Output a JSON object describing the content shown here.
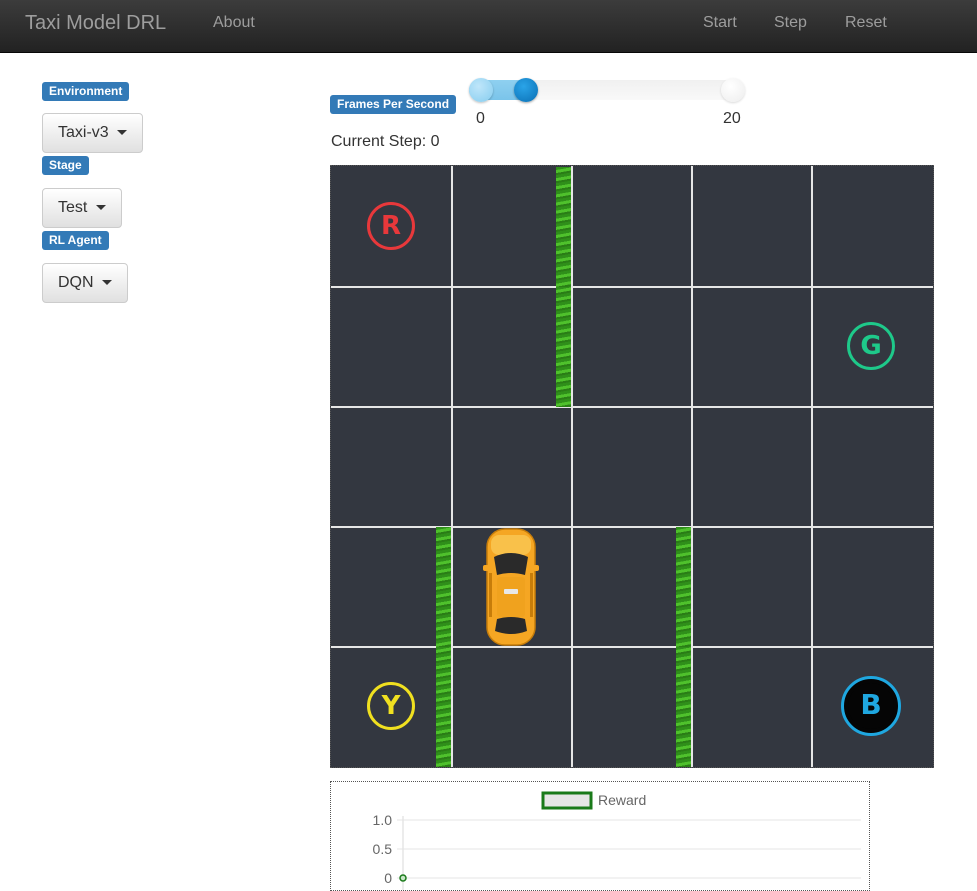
{
  "nav": {
    "brand": "Taxi Model DRL",
    "about": "About",
    "start": "Start",
    "step": "Step",
    "reset": "Reset"
  },
  "sidebar": {
    "environment_label": "Environment",
    "environment_value": "Taxi-v3",
    "stage_label": "Stage",
    "stage_value": "Test",
    "agent_label": "RL Agent",
    "agent_value": "DQN"
  },
  "controls": {
    "fps_label": "Frames Per Second",
    "slider_min": "0",
    "slider_max": "20",
    "slider_value_fraction": 0.15,
    "current_step_text": "Current Step: 0"
  },
  "grid": {
    "rows": 5,
    "cols": 5,
    "locations": [
      {
        "letter": "R",
        "row": 0,
        "col": 0,
        "color": "#e8383b",
        "style": "outline"
      },
      {
        "letter": "G",
        "row": 1,
        "col": 4,
        "color": "#1ec98a",
        "style": "outline"
      },
      {
        "letter": "Y",
        "row": 4,
        "col": 0,
        "color": "#f0e020",
        "style": "outline"
      },
      {
        "letter": "B",
        "row": 4,
        "col": 4,
        "color": "#1fa7e0",
        "style": "filled"
      }
    ],
    "taxi": {
      "row": 3,
      "col": 1
    },
    "walls": [
      {
        "row": 0,
        "between_cols": [
          1,
          2
        ]
      },
      {
        "row": 1,
        "between_cols": [
          1,
          2
        ]
      },
      {
        "row": 3,
        "between_cols": [
          0,
          1
        ]
      },
      {
        "row": 3,
        "between_cols": [
          2,
          3
        ]
      },
      {
        "row": 4,
        "between_cols": [
          0,
          1
        ]
      },
      {
        "row": 4,
        "between_cols": [
          2,
          3
        ]
      }
    ]
  },
  "chart_data": {
    "type": "line",
    "series": [
      {
        "name": "Reward",
        "x": [
          0
        ],
        "values": [
          0
        ]
      }
    ],
    "y_ticks": [
      "1.0",
      "0.5",
      "0"
    ],
    "ylim": [
      0,
      1.0
    ],
    "legend": "top-center",
    "colors": {
      "series": "#1a7a1a"
    }
  }
}
